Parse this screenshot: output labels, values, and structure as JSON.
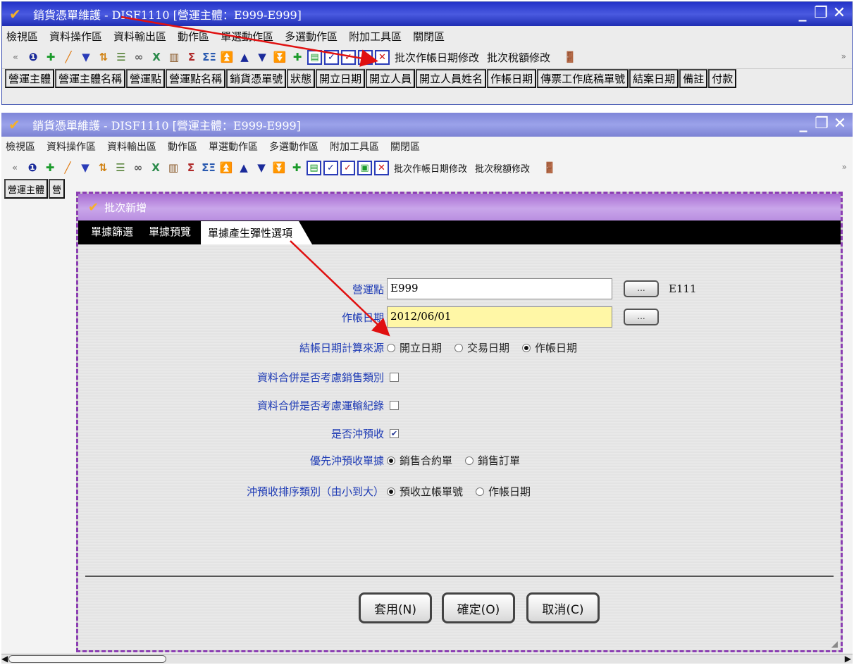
{
  "window_top": {
    "title": "銷貨憑單維護 - DISF1110 [營運主體：E999-E999]",
    "menu": [
      "檢視區",
      "資料操作區",
      "資料輸出區",
      "動作區",
      "單選動作區",
      "多選動作區",
      "附加工具區",
      "關閉區"
    ],
    "toolbar_text_buttons": [
      "批次作帳日期修改",
      "批次稅額修改"
    ],
    "columns": [
      "營運主體",
      "營運主體名稱",
      "營運點",
      "營運點名稱",
      "銷貨憑單號",
      "狀態",
      "開立日期",
      "開立人員",
      "開立人員姓名",
      "作帳日期",
      "傳票工作底稿單號",
      "結案日期",
      "備註",
      "付款"
    ]
  },
  "window_bottom": {
    "title": "銷貨憑單維護 - DISF1110 [營運主體：E999-E999]",
    "menu": [
      "檢視區",
      "資料操作區",
      "資料輸出區",
      "動作區",
      "單選動作區",
      "多選動作區",
      "附加工具區",
      "關閉區"
    ],
    "toolbar_text_buttons": [
      "批次作帳日期修改",
      "批次稅額修改"
    ],
    "columns": [
      "營運主體",
      "營"
    ]
  },
  "dialog": {
    "title": "批次新增",
    "tabs": [
      "單據篩選",
      "單據預覽",
      "單據產生彈性選項"
    ],
    "active_tab": "單據產生彈性選項",
    "fields": {
      "site_label": "營運點",
      "site_value": "E999",
      "site_lookup": "...",
      "site_aux": "E111",
      "date_label": "作帳日期",
      "date_value": "2012/06/01",
      "date_lookup": "...",
      "close_date_label": "結帳日期計算來源",
      "close_date_options": [
        "開立日期",
        "交易日期",
        "作帳日期"
      ],
      "close_date_selected": "作帳日期",
      "merge_sales_label": "資料合併是否考慮銷售類別",
      "merge_sales_checked": false,
      "merge_transport_label": "資料合併是否考慮運輸紀錄",
      "merge_transport_checked": false,
      "offset_prepay_label": "是否沖預收",
      "offset_prepay_checked": true,
      "priority_label": "優先沖預收單據",
      "priority_options": [
        "銷售合約單",
        "銷售訂單"
      ],
      "priority_selected": "銷售合約單",
      "sort_label": "沖預收排序類別（由小到大）",
      "sort_options": [
        "預收立帳單號",
        "作帳日期"
      ],
      "sort_selected": "預收立帳單號"
    },
    "buttons": {
      "apply": "套用(N)",
      "ok": "確定(O)",
      "cancel": "取消(C)"
    }
  },
  "colors": {
    "title_active": "#2333c8",
    "title_inactive": "#8a91df",
    "dialog_title": "#b98ee0",
    "label_blue": "#1e3bb5",
    "annotation_arrow": "#e01010"
  }
}
